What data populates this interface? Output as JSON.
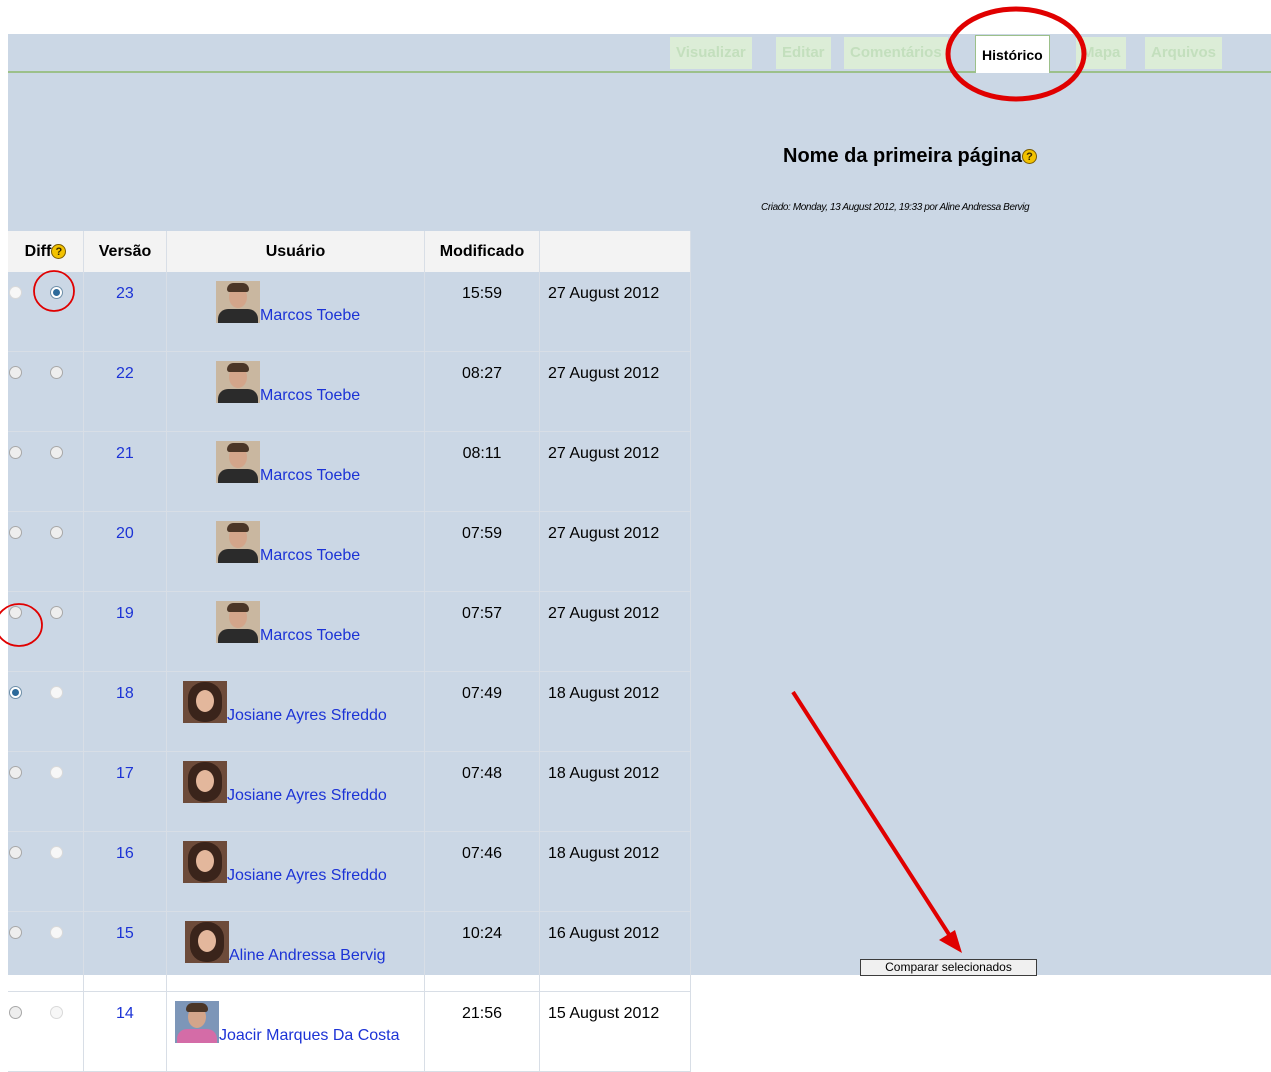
{
  "tabs": [
    {
      "label": "Visualizar"
    },
    {
      "label": "Editar"
    },
    {
      "label": "Comentários"
    },
    {
      "label": "Histórico"
    },
    {
      "label": "Mapa"
    },
    {
      "label": "Arquivos"
    }
  ],
  "page_title": "Nome da primeira página",
  "help_icon_glyph": "?",
  "created_info": "Criado: Monday, 13 August 2012, 19:33 por Aline Andressa Bervig",
  "table": {
    "headers": {
      "diff": "Diff",
      "version": "Versão",
      "user": "Usuário",
      "modified": "Modificado",
      "date": ""
    },
    "rows": [
      {
        "version": "23",
        "user": "Marcos Toebe",
        "time": "15:59",
        "date": "27 August 2012"
      },
      {
        "version": "22",
        "user": "Marcos Toebe",
        "time": "08:27",
        "date": "27 August 2012"
      },
      {
        "version": "21",
        "user": "Marcos Toebe",
        "time": "08:11",
        "date": "27 August 2012"
      },
      {
        "version": "20",
        "user": "Marcos Toebe",
        "time": "07:59",
        "date": "27 August 2012"
      },
      {
        "version": "19",
        "user": "Marcos Toebe",
        "time": "07:57",
        "date": "27 August 2012"
      },
      {
        "version": "18",
        "user": "Josiane Ayres Sfreddo",
        "time": "07:49",
        "date": "18 August 2012"
      },
      {
        "version": "17",
        "user": "Josiane Ayres Sfreddo",
        "time": "07:48",
        "date": "18 August 2012"
      },
      {
        "version": "16",
        "user": "Josiane Ayres Sfreddo",
        "time": "07:46",
        "date": "18 August 2012"
      },
      {
        "version": "15",
        "user": "Aline Andressa Bervig",
        "time": "10:24",
        "date": "16 August 2012"
      },
      {
        "version": "14",
        "user": "Joacir Marques Da Costa",
        "time": "21:56",
        "date": "15 August 2012"
      }
    ]
  },
  "compare_button": "Comparar selecionados",
  "colors": {
    "page_bg": "#cbd7e5",
    "link": "#1c33d6",
    "annotation": "#e00000",
    "tab_border": "#9cc08a"
  }
}
